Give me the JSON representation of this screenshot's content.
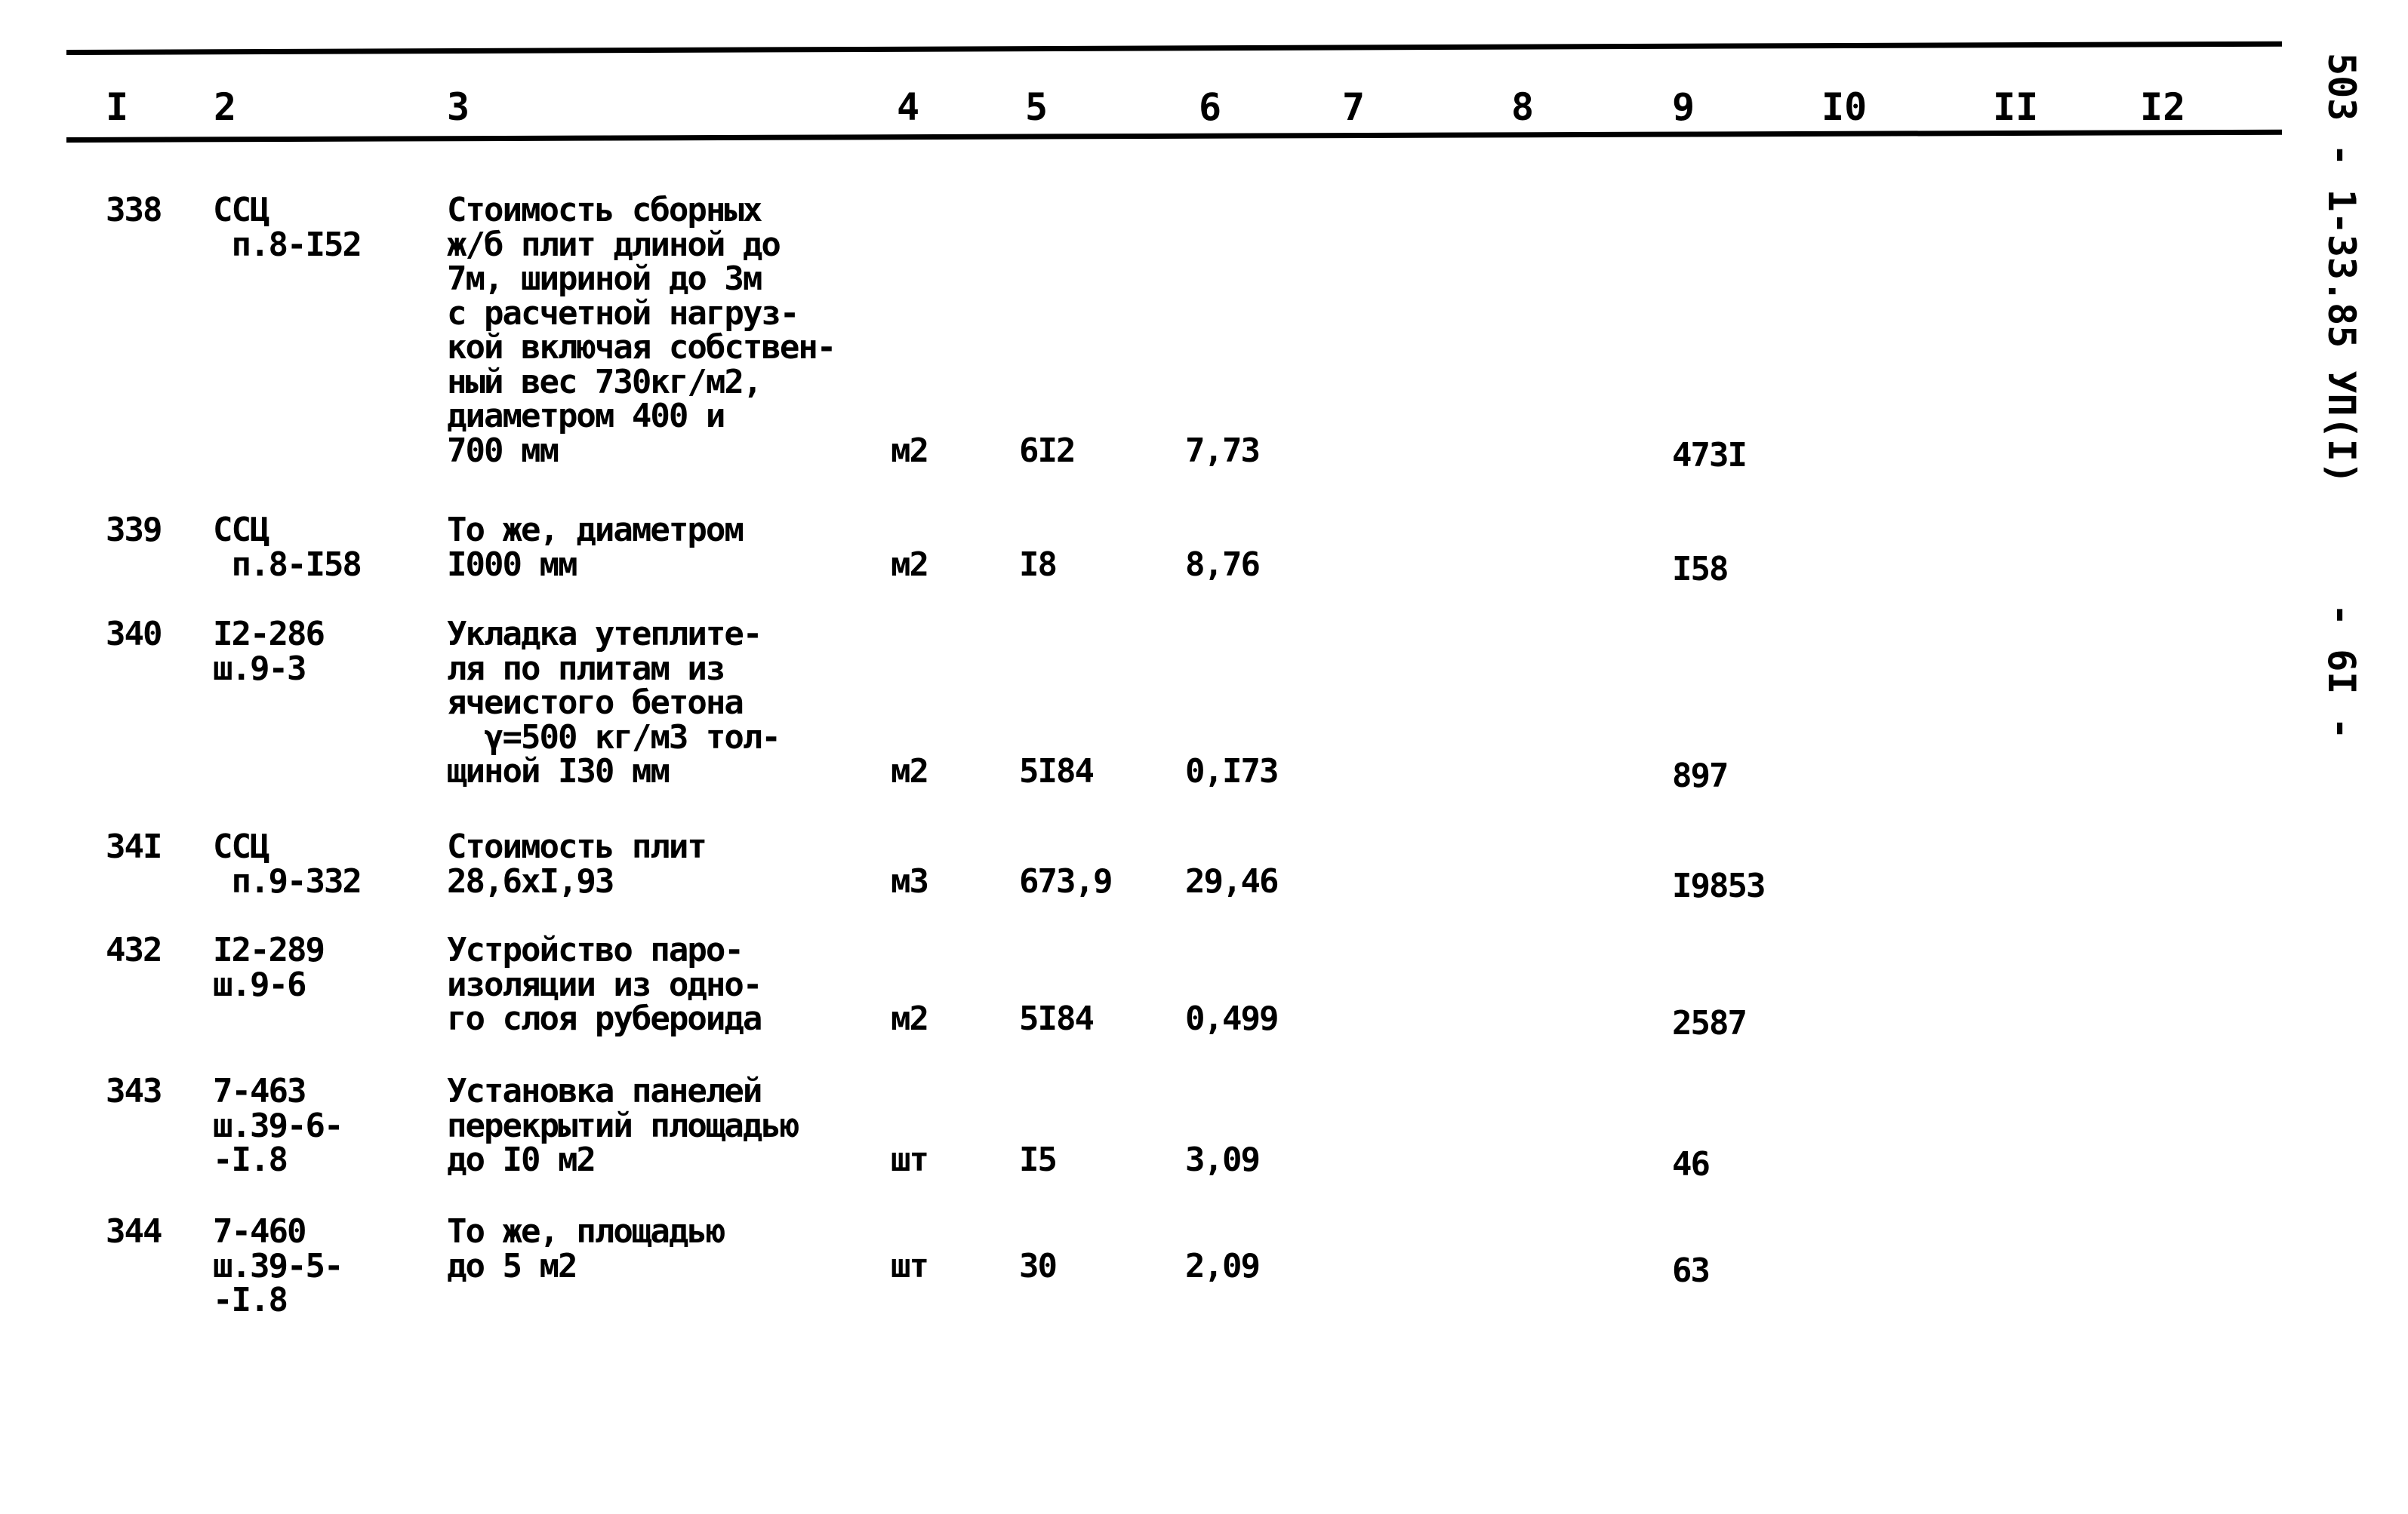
{
  "header": {
    "columns": [
      "I",
      "2",
      "3",
      "4",
      "5",
      "6",
      "7",
      "8",
      "9",
      "I0",
      "II",
      "I2"
    ]
  },
  "side_label": {
    "doc_code": "503 - 1-33.85 УП(I)",
    "page_number": "- 6I -"
  },
  "rows": [
    {
      "no": "338",
      "code": "ССЦ\n п.8-I52",
      "description": "Стоимость сборных\nж/б плит длиной до\n7м, шириной до 3м\nс расчетной нагруз-\nкой включая собствен-\nный вес 730кг/м2,\nдиаметром 400 и\n700 мм",
      "unit": "м2",
      "quantity": "6I2",
      "unit_cost": "7,73",
      "total": "473I"
    },
    {
      "no": "339",
      "code": "ССЦ\n п.8-I58",
      "description": "То же, диаметром\nI000 мм",
      "unit": "м2",
      "quantity": "I8",
      "unit_cost": "8,76",
      "total": "I58"
    },
    {
      "no": "340",
      "code": "I2-286\nш.9-3",
      "description": "Укладка утеплите-\nля по плитам из\nячеистого бетона\n  γ=500 кг/м3 тол-\nщиной I30 мм",
      "unit": "м2",
      "quantity": "5I84",
      "unit_cost": "0,I73",
      "total": "897"
    },
    {
      "no": "34I",
      "code": "ССЦ\n п.9-332",
      "description": "Стоимость плит\n28,6хI,93",
      "unit": "м3",
      "quantity": "673,9",
      "unit_cost": "29,46",
      "total": "I9853"
    },
    {
      "no": "432",
      "code": "I2-289\nш.9-6",
      "description": "Устройство паро-\nизоляции из одно-\nго слоя рубероида",
      "unit": "м2",
      "quantity": "5I84",
      "unit_cost": "0,499",
      "total": "2587"
    },
    {
      "no": "343",
      "code": "7-463\nш.39-6-\n-I.8",
      "description": "Установка панелей\nперекрытий площадью\nдо I0 м2",
      "unit": "шт",
      "quantity": "I5",
      "unit_cost": "3,09",
      "total": "46"
    },
    {
      "no": "344",
      "code": "7-460\nш.39-5-\n-I.8",
      "description": "То же, площадью\nдо 5 м2",
      "unit": "шт",
      "quantity": "30",
      "unit_cost": "2,09",
      "total": "63"
    }
  ]
}
